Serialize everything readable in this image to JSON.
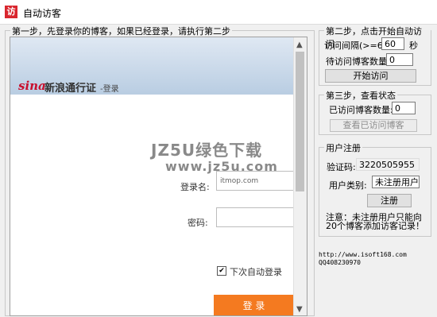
{
  "window": {
    "icon": "访",
    "title": "自动访客"
  },
  "step1": {
    "title": "第一步，先登录你的博客，如果已经登录，请执行第二步"
  },
  "browser": {
    "logo": "sina",
    "site_title": "新浪通行证",
    "site_sub": "-登录",
    "username_label": "登录名:",
    "username_value": "itmop.com",
    "password_label": "密码:",
    "remember_label": "下次自动登录",
    "remember_checked": "✔",
    "login_button": "登 录"
  },
  "step2": {
    "title": "第二步，点击开始自动访问",
    "interval_label": "访问间隔(>=60)",
    "interval_value": "60",
    "interval_unit": "秒",
    "pending_label": "待访问博客数量:",
    "pending_value": "0",
    "start_button": "开始访问"
  },
  "step3": {
    "title": "第三步，查看状态",
    "visited_label": "已访问博客数量:",
    "visited_value": "0",
    "view_button": "查看已访问博客"
  },
  "register": {
    "title": "用户注册",
    "code_label": "验证码:",
    "code_value": "3220505955",
    "type_label": "用户类别:",
    "type_value": "未注册用户",
    "register_button": "注册",
    "note": "注意：未注册用户只能向20个博客添加访客记录！"
  },
  "footer": {
    "url": "http://www.isoft168.com",
    "qq": "QQ408230970"
  },
  "watermark": {
    "line1": "JZ5U绿色下载",
    "line2": "www.jz5u.com"
  }
}
